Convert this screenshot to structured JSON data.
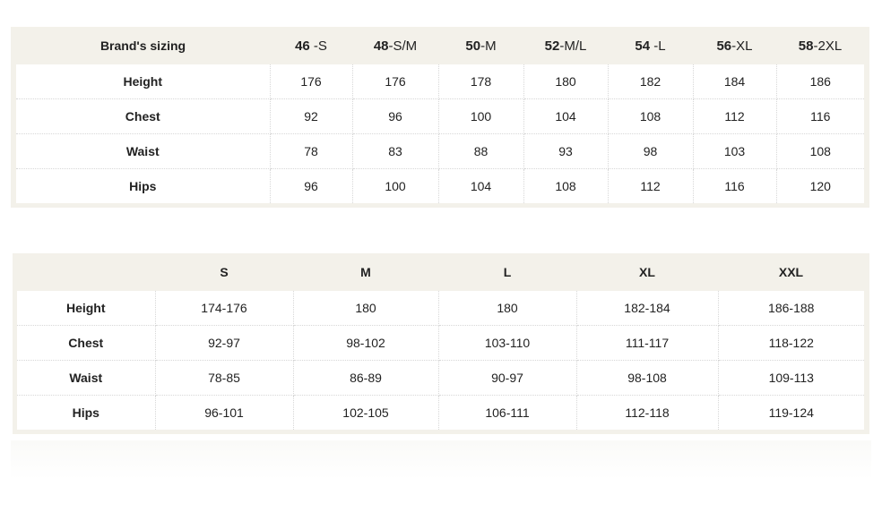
{
  "table1": {
    "header_label": "Brand's sizing",
    "columns": [
      {
        "num": "46",
        "sep": " -",
        "size": "S"
      },
      {
        "num": "48",
        "sep": "-",
        "size": "S/M"
      },
      {
        "num": "50",
        "sep": "-",
        "size": "M"
      },
      {
        "num": "52",
        "sep": "-",
        "size": "M/L"
      },
      {
        "num": "54",
        "sep": " -",
        "size": "L"
      },
      {
        "num": "56",
        "sep": "-",
        "size": "XL"
      },
      {
        "num": "58",
        "sep": "-",
        "size": "2XL"
      }
    ],
    "rows": [
      {
        "label": "Height",
        "values": [
          "176",
          "176",
          "178",
          "180",
          "182",
          "184",
          "186"
        ]
      },
      {
        "label": "Chest",
        "values": [
          "92",
          "96",
          "100",
          "104",
          "108",
          "112",
          "116"
        ]
      },
      {
        "label": "Waist",
        "values": [
          "78",
          "83",
          "88",
          "93",
          "98",
          "103",
          "108"
        ]
      },
      {
        "label": "Hips",
        "values": [
          "96",
          "100",
          "104",
          "108",
          "112",
          "116",
          "120"
        ]
      }
    ]
  },
  "table2": {
    "header_label": "",
    "columns": [
      "S",
      "M",
      "L",
      "XL",
      "XXL"
    ],
    "rows": [
      {
        "label": "Height",
        "values": [
          "174-176",
          "180",
          "180",
          "182-184",
          "186-188"
        ]
      },
      {
        "label": "Chest",
        "values": [
          "92-97",
          "98-102",
          "103-110",
          "111-117",
          "118-122"
        ]
      },
      {
        "label": "Waist",
        "values": [
          "78-85",
          "86-89",
          "90-97",
          "98-108",
          "109-113"
        ]
      },
      {
        "label": "Hips",
        "values": [
          "96-101",
          "102-105",
          "106-111",
          "112-118",
          "119-124"
        ]
      }
    ]
  }
}
